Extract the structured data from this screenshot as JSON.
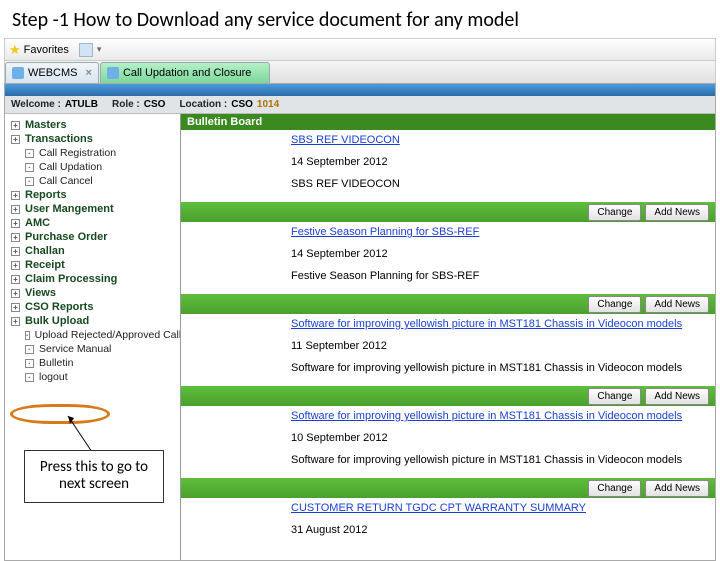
{
  "slide_title": "Step -1 How to Download any service document for any model",
  "browser": {
    "favorites_label": "Favorites",
    "tabs": [
      {
        "label": "WEBCMS",
        "active": false
      },
      {
        "label": "Call Updation and Closure",
        "active": true
      }
    ]
  },
  "welcome": {
    "welcome_label": "Welcome :",
    "user": "ATULB",
    "role_label": "Role :",
    "role": "CSO",
    "location_label": "Location :",
    "location_prefix": "CSO",
    "location_code": "1014"
  },
  "sidebar": [
    {
      "label": "Masters",
      "type": "top"
    },
    {
      "label": "Transactions",
      "type": "top"
    },
    {
      "label": "Call Registration",
      "type": "sub"
    },
    {
      "label": "Call Updation",
      "type": "sub"
    },
    {
      "label": "Call Cancel",
      "type": "sub"
    },
    {
      "label": "Reports",
      "type": "top"
    },
    {
      "label": "User Mangement",
      "type": "top"
    },
    {
      "label": "AMC",
      "type": "top"
    },
    {
      "label": "Purchase Order",
      "type": "top"
    },
    {
      "label": "Challan",
      "type": "top"
    },
    {
      "label": "Receipt",
      "type": "top"
    },
    {
      "label": "Claim Processing",
      "type": "top"
    },
    {
      "label": "Views",
      "type": "top"
    },
    {
      "label": "CSO Reports",
      "type": "top"
    },
    {
      "label": "Bulk Upload",
      "type": "top"
    },
    {
      "label": "Upload Rejected/Approved Calls",
      "type": "sub"
    },
    {
      "label": "Service Manual",
      "type": "sub"
    },
    {
      "label": "Bulletin",
      "type": "sub"
    },
    {
      "label": "logout",
      "type": "sub"
    }
  ],
  "bulletin": {
    "header": "Bulletin Board",
    "change_label": "Change",
    "addnews_label": "Add News",
    "items": [
      {
        "link": "SBS REF VIDEOCON",
        "date": "14 September 2012",
        "desc": "SBS REF VIDEOCON"
      },
      {
        "link": "Festive Season Planning for SBS-REF",
        "date": "14 September 2012",
        "desc": "Festive Season Planning for SBS-REF"
      },
      {
        "link": "Software for improving yellowish picture in MST181 Chassis in Videocon models",
        "date": "11 September 2012",
        "desc": "Software for improving yellowish picture in MST181 Chassis in Videocon models"
      },
      {
        "link": "Software for improving yellowish picture in MST181 Chassis in Videocon models",
        "date": "10 September 2012",
        "desc": "Software for improving yellowish picture in MST181 Chassis in Videocon models"
      },
      {
        "link": "CUSTOMER RETURN TGDC CPT WARRANTY SUMMARY",
        "date": "31 August 2012",
        "desc": ""
      }
    ]
  },
  "callout_text": "Press this to go to next screen"
}
